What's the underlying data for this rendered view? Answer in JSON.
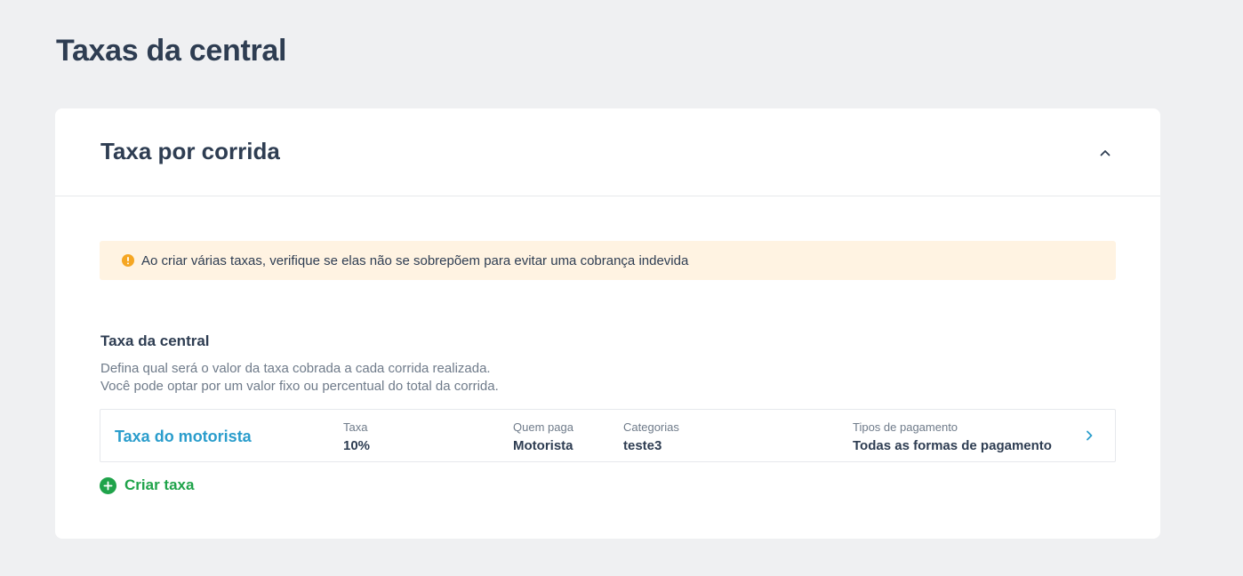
{
  "page": {
    "title": "Taxas da central"
  },
  "card": {
    "title": "Taxa por corrida",
    "collapse_icon": "chevron-up-icon"
  },
  "alert": {
    "icon": "info-icon",
    "text": "Ao criar várias taxas, verifique se elas não se sobrepõem para evitar uma cobrança indevida",
    "color": "#f5a623"
  },
  "section": {
    "title": "Taxa da central",
    "description_line1": "Defina qual será o valor da taxa cobrada a cada corrida realizada.",
    "description_line2": "Você pode optar por um valor fixo ou percentual do total da corrida."
  },
  "fees": [
    {
      "name": "Taxa do motorista",
      "taxa_label": "Taxa",
      "taxa_value": "10%",
      "quem_paga_label": "Quem paga",
      "quem_paga_value": "Motorista",
      "categorias_label": "Categorias",
      "categorias_value": "teste3",
      "tipos_label": "Tipos de pagamento",
      "tipos_value": "Todas as formas de pagamento"
    }
  ],
  "create_button": {
    "label": "Criar taxa",
    "icon": "plus-circle-icon",
    "color": "#1fa34a"
  },
  "colors": {
    "accent": "#2a9dcc",
    "background": "#eff0f2",
    "heading": "#2e3d52"
  }
}
